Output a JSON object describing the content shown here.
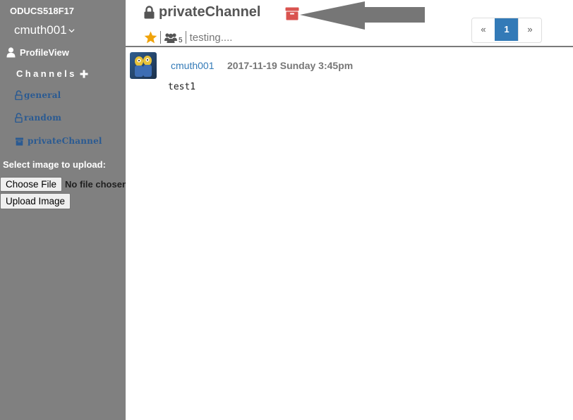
{
  "sidebar": {
    "team_name": "ODUCS518F17",
    "username": "cmuth001",
    "profile_label": "ProfileView",
    "channels_heading": "Channels",
    "channels": [
      {
        "label": "general",
        "icon": "unlock-icon"
      },
      {
        "label": "random",
        "icon": "unlock-icon"
      },
      {
        "label": "privateChannel",
        "icon": "archive-icon"
      }
    ],
    "upload": {
      "label": "Select image to upload:",
      "choose_button": "Choose File",
      "file_status": "No file chosen",
      "upload_button": "Upload Image"
    }
  },
  "header": {
    "channel_name": "privateChannel",
    "channel_icon": "lock-icon",
    "member_count": "5",
    "purpose": "testing...."
  },
  "pagination": {
    "prev": "«",
    "pages": [
      "1"
    ],
    "active_page": "1",
    "next": "»"
  },
  "messages": [
    {
      "author": "cmuth001",
      "timestamp": "2017-11-19 Sunday 3:45pm",
      "text": "test1"
    }
  ],
  "colors": {
    "sidebar_bg": "#808080",
    "channel_link": "#2a5a92",
    "archive_red": "#d9534f",
    "star": "#f0a30a",
    "pager_active": "#337ab7"
  }
}
